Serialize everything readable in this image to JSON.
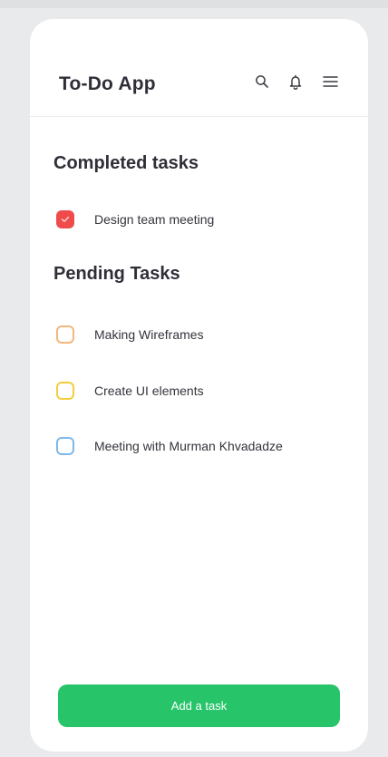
{
  "colors": {
    "accent": "#27c46a",
    "checked": "#f04b4b",
    "background": "#e9eaec",
    "card": "#ffffff"
  },
  "header": {
    "title": "To-Do App",
    "icons": [
      "search-icon",
      "bell-icon",
      "menu-icon"
    ]
  },
  "completed": {
    "title": "Completed tasks",
    "tasks": [
      {
        "label": "Design team meeting",
        "checked": true,
        "color": "#f04b4b"
      }
    ]
  },
  "pending": {
    "title": "Pending Tasks",
    "tasks": [
      {
        "label": "Making Wireframes",
        "checked": false,
        "color": "#f2b77d"
      },
      {
        "label": "Create UI elements",
        "checked": false,
        "color": "#f3cd3e"
      },
      {
        "label": "Meeting with Murman Khvadadze",
        "checked": false,
        "color": "#7db8ea"
      }
    ]
  },
  "footer": {
    "add_label": "Add a task"
  }
}
